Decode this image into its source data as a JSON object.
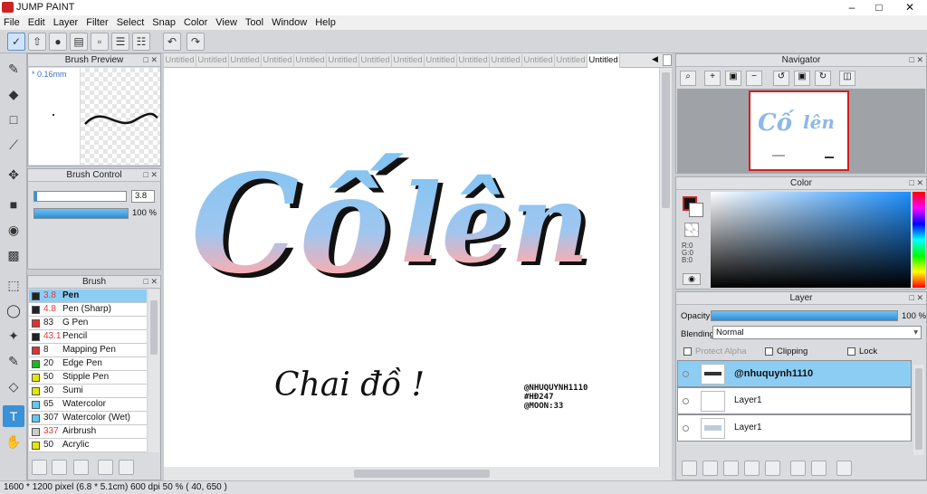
{
  "app": {
    "title": "JUMP PAINT"
  },
  "menu": [
    "File",
    "Edit",
    "Layer",
    "Filter",
    "Select",
    "Snap",
    "Color",
    "View",
    "Tool",
    "Window",
    "Help"
  ],
  "tabs": [
    "Untitled",
    "Untitled",
    "Untitled",
    "Untitled",
    "Untitled",
    "Untitled",
    "Untitled",
    "Untitled",
    "Untitled",
    "Untitled",
    "Untitled",
    "Untitled",
    "Untitled",
    "Untitled"
  ],
  "brush_preview": {
    "title": "Brush Preview",
    "size": "* 0.16mm"
  },
  "brush_control": {
    "title": "Brush Control",
    "size_value": "3.8",
    "opacity_value": "100 %"
  },
  "brush": {
    "title": "Brush",
    "items": [
      {
        "size": "3.8",
        "name": "Pen",
        "color": "#222222",
        "red": true
      },
      {
        "size": "4.8",
        "name": "Pen (Sharp)",
        "color": "#222222",
        "red": true
      },
      {
        "size": "83",
        "name": "G Pen",
        "color": "#e03030",
        "red": false
      },
      {
        "size": "43.1",
        "name": "Pencil",
        "color": "#222222",
        "red": true
      },
      {
        "size": "8",
        "name": "Mapping Pen",
        "color": "#e03030",
        "red": false
      },
      {
        "size": "20",
        "name": "Edge Pen",
        "color": "#1db81d",
        "red": false
      },
      {
        "size": "50",
        "name": "Stipple Pen",
        "color": "#e6e600",
        "red": false
      },
      {
        "size": "30",
        "name": "Sumi",
        "color": "#e6e600",
        "red": false
      },
      {
        "size": "65",
        "name": "Watercolor",
        "color": "#5fc8f5",
        "red": false
      },
      {
        "size": "307",
        "name": "Watercolor (Wet)",
        "color": "#5fc8f5",
        "red": false
      },
      {
        "size": "337",
        "name": "Airbrush",
        "color": "#cccccc",
        "red": true
      },
      {
        "size": "50",
        "name": "Acrylic",
        "color": "#e6e600",
        "red": false
      }
    ]
  },
  "navigator": {
    "title": "Navigator"
  },
  "color": {
    "title": "Color",
    "r": "R:0",
    "g": "G:0",
    "b": "B:0"
  },
  "layer": {
    "title": "Layer",
    "opacity_label": "Opacity",
    "opacity_value": "100 %",
    "blending_label": "Blending",
    "blending_value": "Normal",
    "protect_alpha": "Protect Alpha",
    "clipping": "Clipping",
    "lock": "Lock",
    "items": [
      {
        "name": "@nhuquynh1110"
      },
      {
        "name": "Layer1"
      },
      {
        "name": "Layer1"
      }
    ]
  },
  "canvas": {
    "title_line1": "Cố",
    "title_line2": "lên",
    "handwriting": "Chai đồ !",
    "credits": [
      "@NHUQUYNH1110",
      "#HĐ247",
      "@MOON:33"
    ]
  },
  "status": {
    "text": "1600 * 1200 pixel  (6.8 * 5.1cm)  600 dpi  50 %  ( 40, 650 )"
  },
  "colors": {
    "accent": "#3a91d6",
    "selected_row": "#8ccdf4"
  }
}
